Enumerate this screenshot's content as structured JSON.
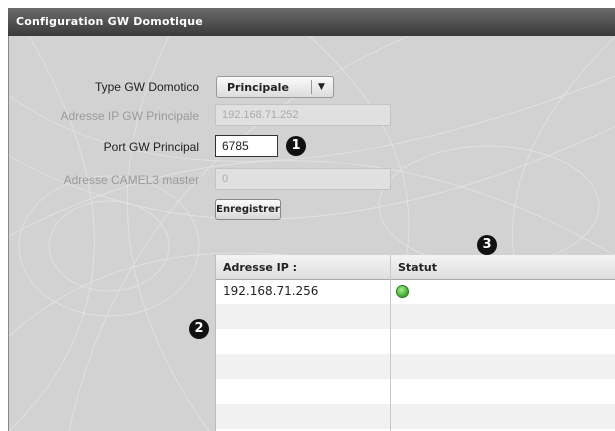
{
  "window": {
    "title": "Configuration GW Domotique"
  },
  "form": {
    "type_label": "Type GW Domotico",
    "type_value": "Principale",
    "ip_label": "Adresse IP GW Principale",
    "ip_value": "192.168.71.252",
    "port_label": "Port GW Principal",
    "port_value": "6785",
    "camel_label": "Adresse CAMEL3 master",
    "camel_value": "0",
    "save_label": "Enregistrer"
  },
  "callouts": [
    "1",
    "2",
    "3"
  ],
  "table": {
    "headers": [
      "Adresse IP :",
      "Statut"
    ],
    "rows": [
      {
        "ip": "192.168.71.256",
        "status": "green"
      }
    ]
  },
  "colors": {
    "title_bar": "#4a4a4a",
    "panel": "#d2d2d2",
    "status_ok": "#3aa82a"
  }
}
